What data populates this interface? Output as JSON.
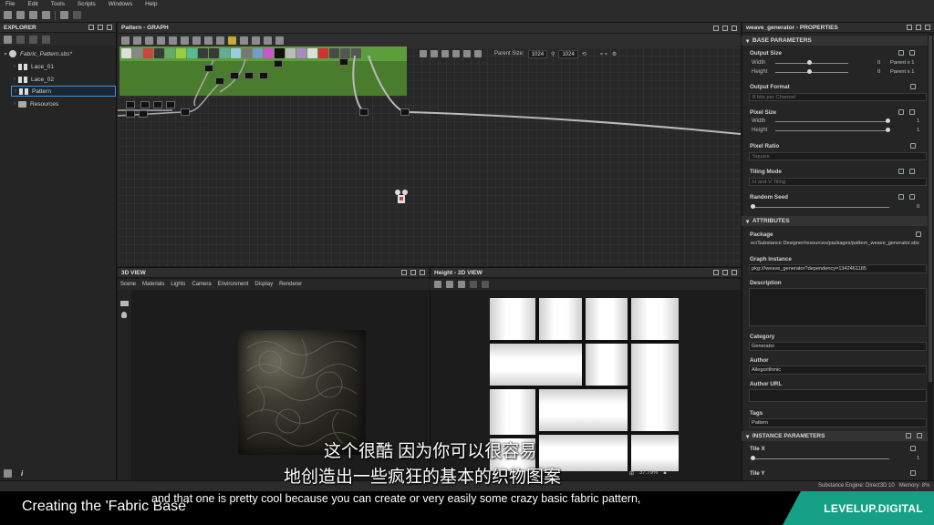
{
  "menu": [
    "File",
    "Edit",
    "Tools",
    "Scripts",
    "Windows",
    "Help"
  ],
  "explorer": {
    "title": "EXPLORER",
    "package": "Fabric_Pattern.sbs*",
    "items": [
      "Lace_01",
      "Lace_02",
      "Pattern",
      "Resources"
    ]
  },
  "graph": {
    "title": "Pattern - GRAPH",
    "parent_size_label": "Parent Size:",
    "parent_size_w": "1024",
    "parent_size_h": "1024"
  },
  "view3d": {
    "title": "3D VIEW",
    "menu": [
      "Scene",
      "Materials",
      "Lights",
      "Camera",
      "Environment",
      "Display",
      "Renderer"
    ]
  },
  "view2d": {
    "title": "Height - 2D VIEW",
    "zoom": "37.79%"
  },
  "properties": {
    "title": "weave_generator - PROPERTIES",
    "base_section": "BASE PARAMETERS",
    "output_size": {
      "label": "Output Size",
      "width_label": "Width",
      "height_label": "Height",
      "width_value": "0",
      "height_value": "0",
      "width_mode": "Parent x 1",
      "height_mode": "Parent x 1"
    },
    "output_format": {
      "label": "Output Format",
      "value": "8 bits per Channel"
    },
    "pixel_size": {
      "label": "Pixel Size",
      "width_label": "Width",
      "height_label": "Height",
      "width_value": "1",
      "height_value": "1"
    },
    "pixel_ratio": {
      "label": "Pixel Ratio",
      "value": "Square"
    },
    "tiling_mode": {
      "label": "Tiling Mode",
      "value": "H and V Tiling"
    },
    "random_seed": {
      "label": "Random Seed",
      "value": "0"
    },
    "attributes_section": "ATTRIBUTES",
    "package": {
      "label": "Package",
      "value": "ec/Substance Designer/resources/packages/pattern_weave_generator.sbs"
    },
    "graph_instance": {
      "label": "Graph instance",
      "value": "pkg:///weave_generator?dependency=1342461185"
    },
    "description": {
      "label": "Description"
    },
    "category": {
      "label": "Category",
      "value": "Generator"
    },
    "author": {
      "label": "Author",
      "value": "Allegorithmic"
    },
    "author_url": {
      "label": "Author URL"
    },
    "tags": {
      "label": "Tags",
      "value": "Pattern"
    },
    "instance_section": "INSTANCE PARAMETERS",
    "tile_x": {
      "label": "Tile X",
      "value": "1"
    },
    "tile_y": {
      "label": "Tile Y"
    }
  },
  "status": {
    "engine": "Substance Engine: Direct3D 10",
    "memory": "Memory: 8%"
  },
  "overlay": {
    "course_title": "Creating the 'Fabric Base'",
    "brand": "LEVELUP.DIGITAL",
    "subtitle_cn_1": "这个很酷 因为你可以很容易",
    "subtitle_cn_2": "地创造出一些疯狂的基本的织物图案",
    "subtitle_en": "and that one is pretty cool because you can create or very easily some crazy basic fabric pattern,"
  },
  "colors": {
    "frame_green": "#5d9e3c",
    "brand_teal": "#16a085",
    "selection_blue": "#4a90d9"
  }
}
